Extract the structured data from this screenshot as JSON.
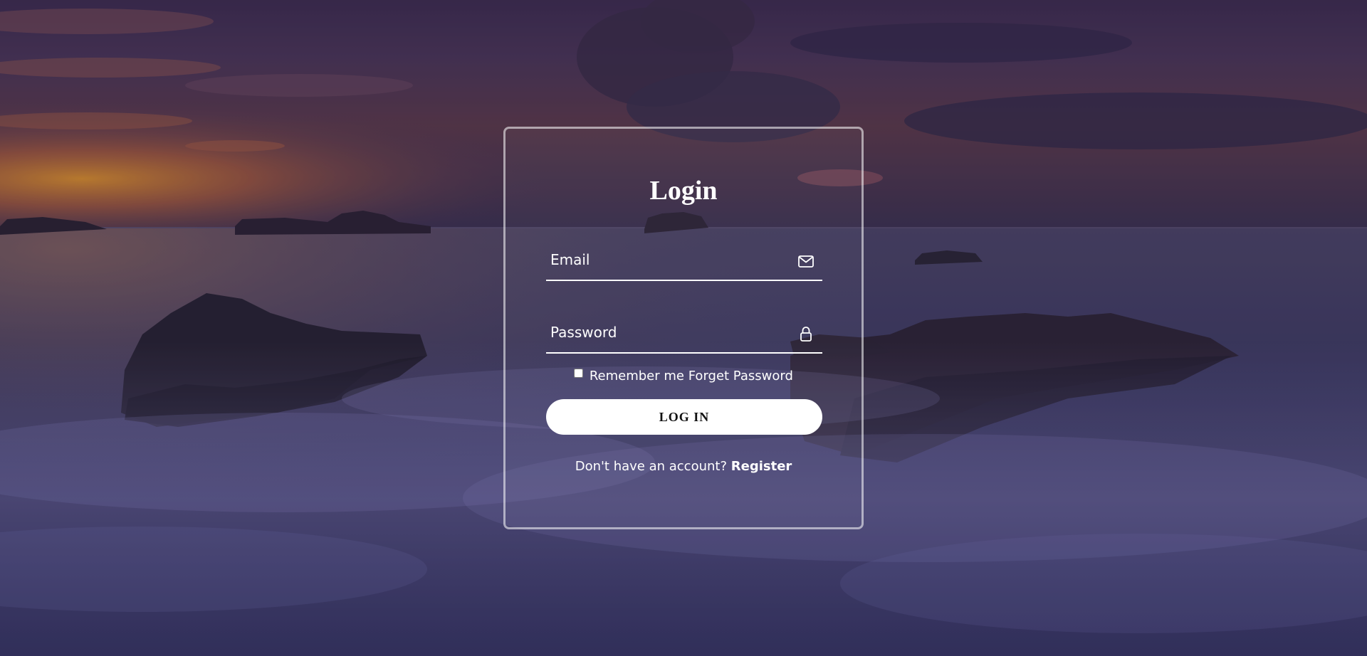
{
  "login": {
    "title": "Login",
    "email_placeholder": "Email",
    "password_placeholder": "Password",
    "remember_label": "Remember me",
    "forget_label": "Forget Password",
    "button_label": "LOG IN",
    "no_account_text": "Don't have an account?",
    "register_label": "Register"
  },
  "icons": {
    "email": "envelope-icon",
    "password": "lock-icon"
  },
  "colors": {
    "text": "#ffffff",
    "button_bg": "#ffffff",
    "button_text": "#111111",
    "card_border": "rgba(255,255,255,0.55)"
  }
}
